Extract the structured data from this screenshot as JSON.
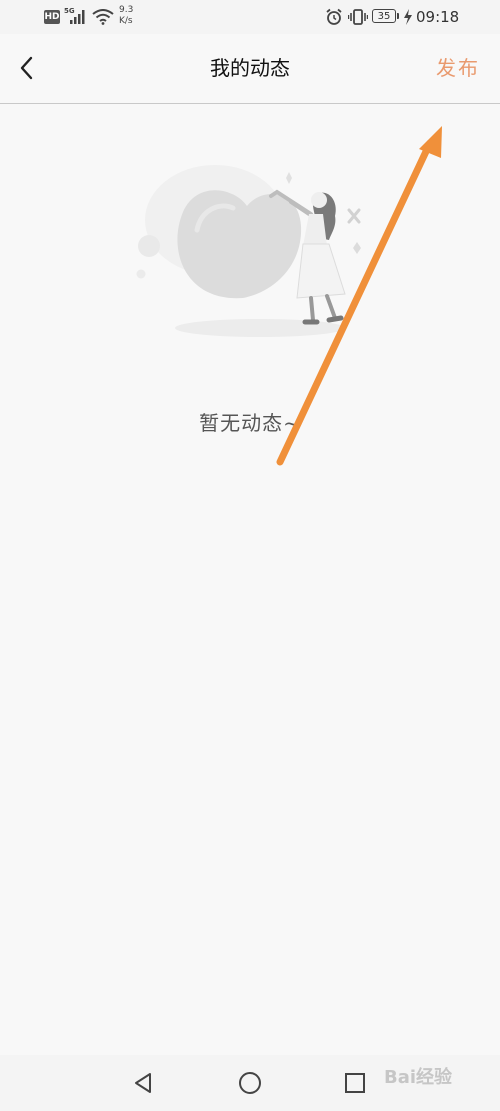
{
  "status_bar": {
    "hd_badge": "HD",
    "network": "5G",
    "speed_value": "9.3",
    "speed_unit": "K/s",
    "battery": "35",
    "time": "09:18"
  },
  "header": {
    "title": "我的动态",
    "publish_label": "发布",
    "back_icon": "chevron-left-icon"
  },
  "main": {
    "empty_text": "暂无动态~"
  },
  "nav": {
    "back_icon": "triangle-back-icon",
    "home_icon": "circle-home-icon",
    "recent_icon": "square-recent-icon"
  },
  "watermark": {
    "text": "Bai经验"
  },
  "colors": {
    "accent": "#e99a6e",
    "annotation_arrow": "#f0903a",
    "background": "#f8f8f8"
  }
}
